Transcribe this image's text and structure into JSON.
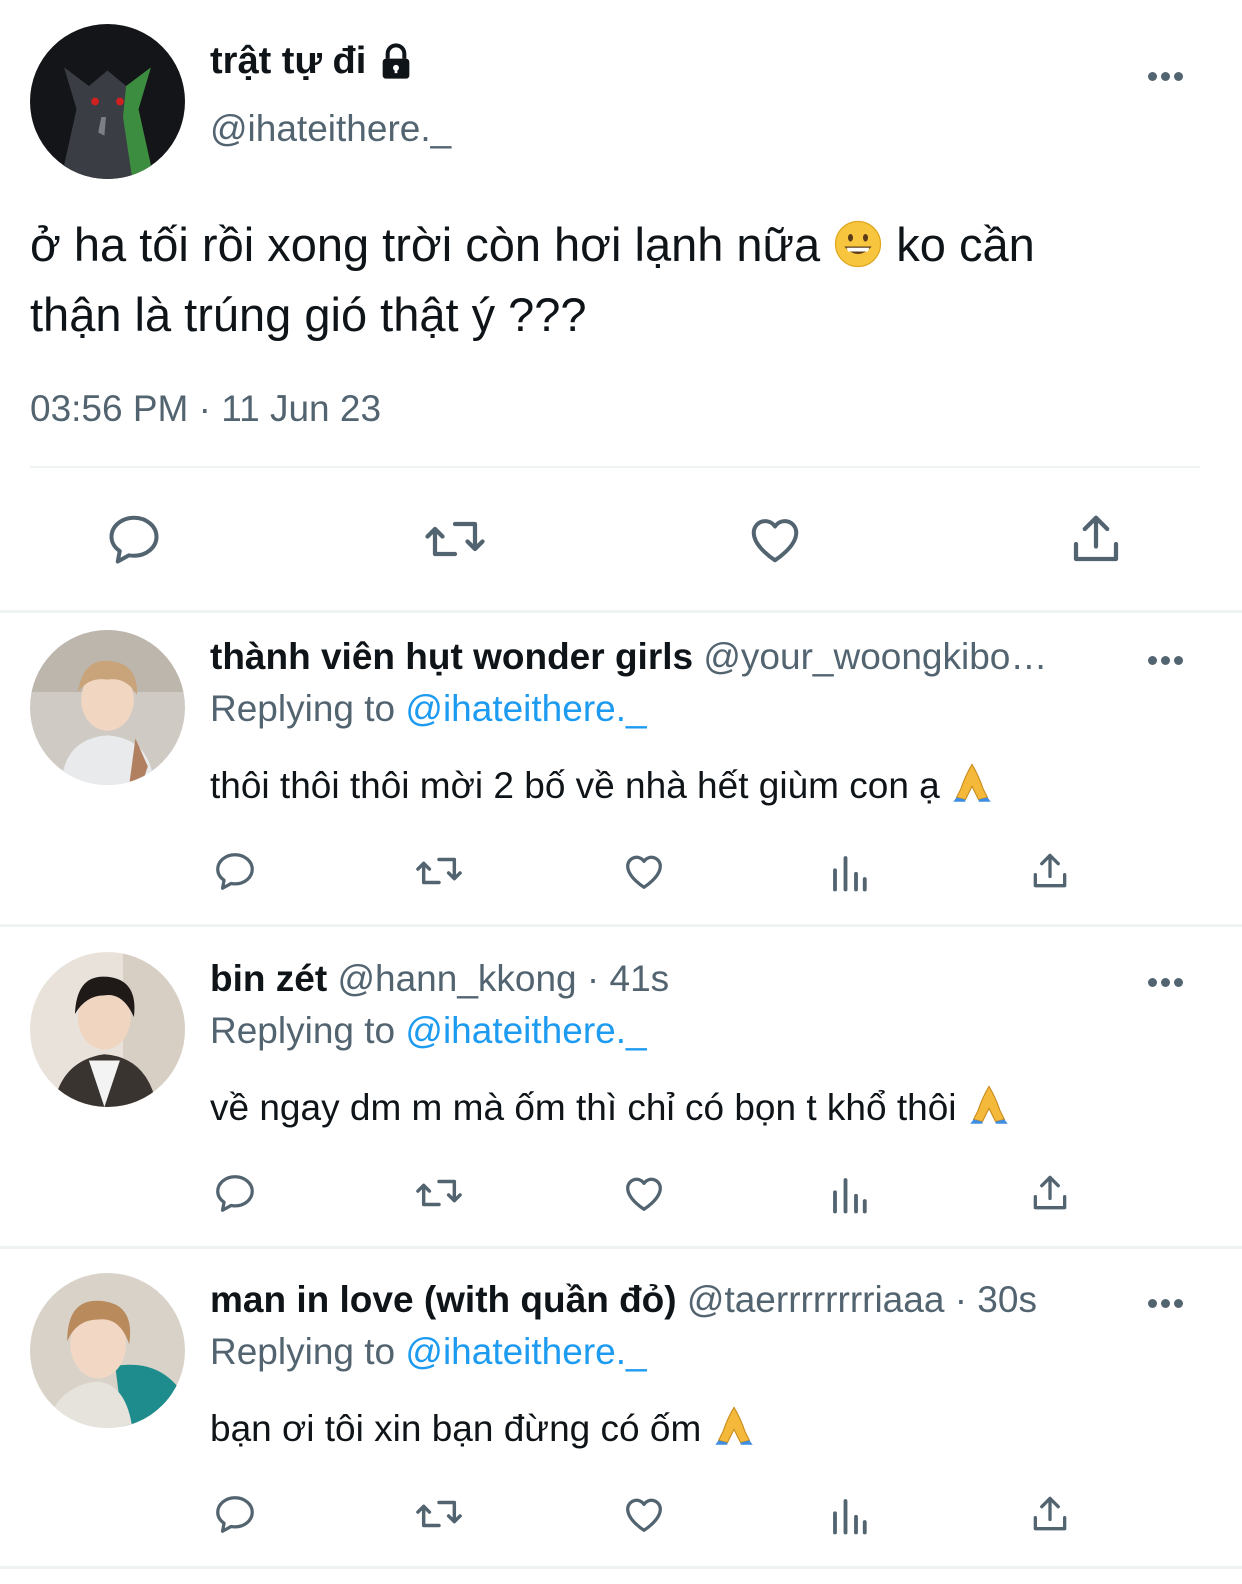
{
  "main_tweet": {
    "display_name": "trật tự đi",
    "handle": "@ihateithere._",
    "text_line1": "ở ha tối rồi xong trời còn hơi lạnh nữa",
    "text_line1_after": "ko cần",
    "text_line2": "thận là trúng gió thật ý ???",
    "emoji": "grinning-face",
    "timestamp": "03:56 PM · 11 Jun 23"
  },
  "replies": [
    {
      "display_name": "thành viên hụt wonder girls",
      "meta": "@your_woongkibo…",
      "replying_prefix": "Replying to",
      "replying_to": "@ihateithere._",
      "text": "thôi thôi thôi mời 2 bố về nhà hết giùm con ạ",
      "emoji": "folded-hands"
    },
    {
      "display_name": "bin zét",
      "meta": "@hann_kkong · 41s",
      "replying_prefix": "Replying to",
      "replying_to": "@ihateithere._",
      "text": "về ngay dm m mà ốm thì chỉ có bọn t khổ thôi",
      "emoji": "folded-hands"
    },
    {
      "display_name": "man in love (with quần đỏ)",
      "meta": "@taerrrrrrrriaaa · 30s",
      "replying_prefix": "Replying to",
      "replying_to": "@ihateithere._",
      "text": "bạn ơi tôi xin bạn đừng có ốm",
      "emoji": "folded-hands"
    }
  ],
  "icons": {
    "reply": "reply-icon",
    "retweet": "retweet-icon",
    "like": "like-icon",
    "views": "views-icon",
    "share": "share-icon",
    "more": "more-icon",
    "lock": "lock-icon"
  },
  "colors": {
    "text": "#0f1419",
    "secondary": "#536471",
    "link": "#1d9bf0",
    "divider": "#eff3f4"
  }
}
